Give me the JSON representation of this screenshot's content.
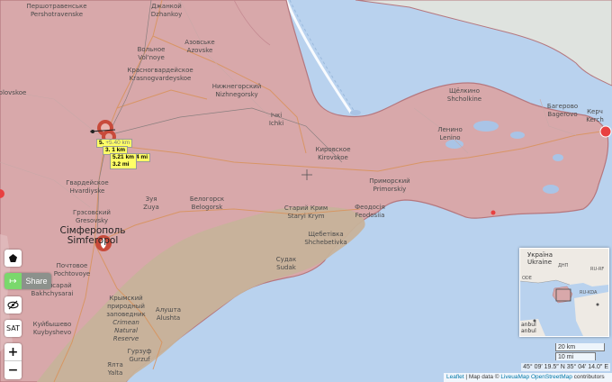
{
  "places": {
    "pershotravenske": "Першотравенське",
    "pershotravenske_lat": "Pershotravenske",
    "dzhankoi": "Джанкой",
    "dzhankoi_lat": "Dzhankoy",
    "volnoe": "Вольное",
    "volnoe_lat": "Vol'noye",
    "azovske": "Азовське",
    "azovske_lat": "Azovske",
    "krasnogvardeyskoe": "Красногвардейское",
    "krasnogvardeyskoe_lat": "Krasnogvardeyskoe",
    "nizhnegorsky": "Нижнегорский",
    "nizhnegorsky_lat": "Nizhnegorsky",
    "ichki": "Ічкі",
    "ichki_lat": "Ichki",
    "kirovskoe": "Кировское",
    "kirovskoe_lat": "Kirovskoe",
    "shcholkino": "Щёлкино",
    "shcholkino_lat": "Shcholkine",
    "bagerovo": "Багерово",
    "bagerovo_lat": "Bagerovo",
    "kerch": "Керч",
    "kerch_lat": "Kerch",
    "lenino": "Ленино",
    "lenino_lat": "Lenino",
    "primorsky": "Приморский",
    "primorsky_lat": "Primorskiy",
    "feodosia": "Феодосія",
    "feodosia_lat": "Feodosiia",
    "stary_krym": "Старий Крим",
    "stary_krym_lat": "Staryi Krym",
    "shchebetovka": "Щебетівка",
    "shchebetovka_lat": "Shchebetivka",
    "sudak": "Судак",
    "sudak_lat": "Sudak",
    "belogorsk": "Белогорск",
    "belogorsk_lat": "Belogorsk",
    "zuya": "Зуя",
    "zuya_lat": "Zuya",
    "gvardeyskoe": "Гвардейское",
    "gvardeyskoe_lat": "Hvardiyske",
    "gresovsky": "Грэсовский",
    "gresovsky_lat": "Gresovsky",
    "simferopol": "Сімферополь",
    "simferopol_lat": "Simferopol",
    "pochtovoe": "Почтовое",
    "pochtovoe_lat": "Pochtovoye",
    "bakhchysarai": "Бахчисарай",
    "bakhchysarai_lat": "Bakhchysarai",
    "kuybyshevo": "Куйбышево",
    "kuybyshevo_lat": "Kuybyshevo",
    "reserve_1": "Крымский",
    "reserve_2": "природный",
    "reserve_3": "заповедник",
    "reserve_4": "Crimean",
    "reserve_5": "Natural",
    "reserve_6": "Reserve",
    "alushta": "Алушта",
    "alushta_lat": "Alushta",
    "gurzuf": "Гурзуф",
    "gurzuf_lat": "Gurzuf",
    "yalta": "Ялта",
    "yalta_lat": "Yalta",
    "left_edge": "olovskoe"
  },
  "markers": {
    "label_a": "5.",
    "label_a_km": "+5.40 km",
    "label_b": "3.",
    "label_b_km": "1 km",
    "label_c": "5.21 km",
    "label_c_mi": "3.2 mi",
    "label_d": "4 mi"
  },
  "controls": {
    "share_label": "Share",
    "sat_label": "SAT",
    "zoom_in": "+",
    "zoom_out": "−"
  },
  "minimap": {
    "country": "Україна",
    "country_lat": "Ukraine",
    "code_left": "ODE",
    "code_mid": "ДНП",
    "code_rf": "RU-RF",
    "code_kda": "RU-KDA",
    "city": "anbul",
    "city2": "anbul"
  },
  "scale": {
    "km": "20 km",
    "mi": "10 mi"
  },
  "coordinates": "45° 09′ 19.5″ N 35° 04′ 14.0″ E",
  "attribution": {
    "leaflet": "Leaflet",
    "sep": " | Map data © ",
    "liveuamap": "LiveuaMap",
    "osm": "OpenStreetMap",
    "contrib": " contributors"
  },
  "colors": {
    "sea": "#b9d2ee",
    "occupied": "#d8a8aa",
    "mountains": "#c7b29a",
    "border": "#b5777e",
    "marker": "#c0392b"
  }
}
